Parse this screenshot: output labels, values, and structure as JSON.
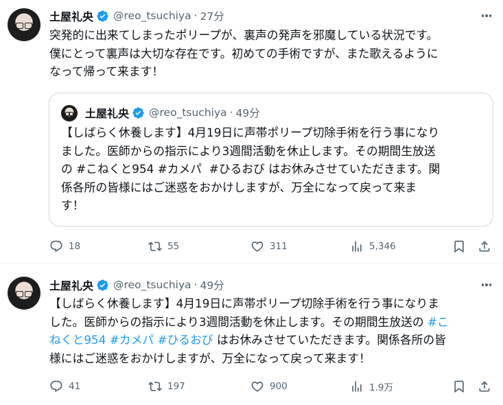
{
  "tweets": [
    {
      "author": {
        "name": "土屋礼央",
        "handle": "@reo_tsuchiya",
        "time": "27分"
      },
      "lines": [
        "突発的に出来てしまったポリープが、裏声の発声を邪魔している状況です。",
        "僕にとって裏声は大切な存在です。初めての手術ですが、また歌えるように",
        "なって帰って来ます！"
      ],
      "quote": {
        "author": {
          "name": "土屋礼央",
          "handle": "@reo_tsuchiya",
          "time": "49分"
        },
        "line1": "【しばらく休養します】4月19日に声帯ポリープ切除手術を行う事になり",
        "line2": "ました。医師からの指示により3週間活動を休止します。その期間生放送",
        "line3_pre": "の ",
        "tag1": "#こねくと954",
        "tag2": "#カメパ",
        "tag3": "#ひるおび",
        "line3_post": " はお休みさせていただきます。関",
        "line4": "係各所の皆様にはご迷惑をおかけしますが、万全になって戻って来ま",
        "line5": "す！"
      },
      "stats": {
        "replies": "18",
        "reposts": "55",
        "likes": "311",
        "views": "5,346"
      }
    },
    {
      "author": {
        "name": "土屋礼央",
        "handle": "@reo_tsuchiya",
        "time": "49分"
      },
      "line1": "【しばらく休養します】4月19日に声帯ポリープ切除手術を行う事になりま",
      "line2_pre": "した。医師からの指示により3週間活動を休止します。その期間生放送の ",
      "tag1_a": "#こ",
      "tag1_b": "ねくと954",
      "tag2": "#カメパ",
      "tag3": "#ひるおび",
      "line3_post": " はお休みさせていただきます。関係各所の皆",
      "line4": "様にはご迷惑をおかけしますが、万全になって戻って来ます！",
      "stats": {
        "replies": "41",
        "reposts": "197",
        "likes": "900",
        "views": "1.9万"
      }
    }
  ],
  "colors": {
    "link": "#1d9bf0",
    "secondary": "#536471",
    "verified": "#1d9bf0",
    "border": "#cfd9de"
  },
  "icons": [
    "reply-icon",
    "repost-icon",
    "like-icon",
    "views-icon",
    "bookmark-icon",
    "share-icon",
    "verified-badge-icon",
    "more-icon"
  ]
}
